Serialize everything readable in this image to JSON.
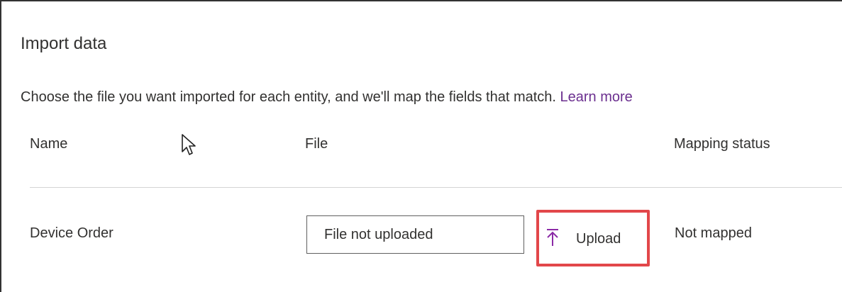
{
  "dialog": {
    "title": "Import data",
    "description": "Choose the file you want imported for each entity, and we'll map the fields that match.",
    "learn_more": "Learn more"
  },
  "table": {
    "columns": {
      "name": "Name",
      "file": "File",
      "status": "Mapping status"
    },
    "rows": [
      {
        "name": "Device Order",
        "file_value": "File not uploaded",
        "upload_label": "Upload",
        "status": "Not mapped"
      }
    ]
  },
  "colors": {
    "link": "#6b2f8f",
    "upload_icon": "#8b2aa6",
    "highlight": "#e2474a"
  },
  "icons": {
    "upload": "upload-arrow-icon",
    "cursor": "mouse-pointer-icon"
  }
}
